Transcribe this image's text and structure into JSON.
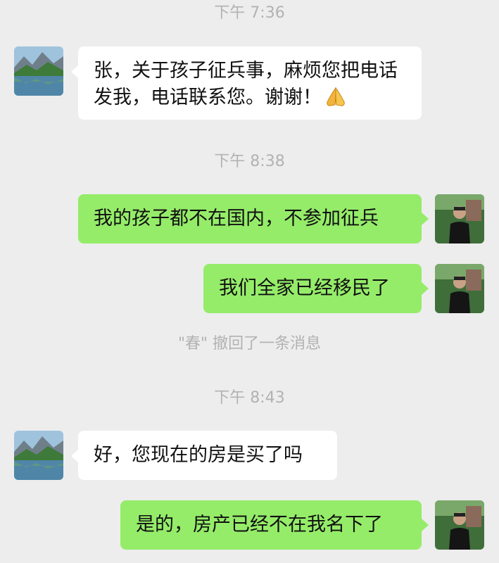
{
  "chat": {
    "time_1": "下午 7:36",
    "time_2": "下午 8:38",
    "time_3": "下午 8:43",
    "recall_notice": "\"春\" 撤回了一条消息",
    "messages": [
      {
        "side": "incoming",
        "text": "张，关于孩子征兵事，麻烦您把电话发我，电话联系您。谢谢！",
        "emoji": "folded-hands-icon"
      },
      {
        "side": "outgoing",
        "text": "我的孩子都不在国内，不参加征兵"
      },
      {
        "side": "outgoing",
        "text": "我们全家已经移民了"
      },
      {
        "side": "incoming",
        "text": "好，您现在的房是买了吗"
      },
      {
        "side": "outgoing",
        "text": "是的，房产已经不在我名下了"
      }
    ]
  },
  "colors": {
    "background": "#ededed",
    "incoming_bubble": "#ffffff",
    "outgoing_bubble": "#95ec69",
    "timestamp": "#b2b2b2"
  },
  "avatars": {
    "contact": "landscape-lake-avatar-icon",
    "self": "person-outdoor-avatar-icon"
  }
}
